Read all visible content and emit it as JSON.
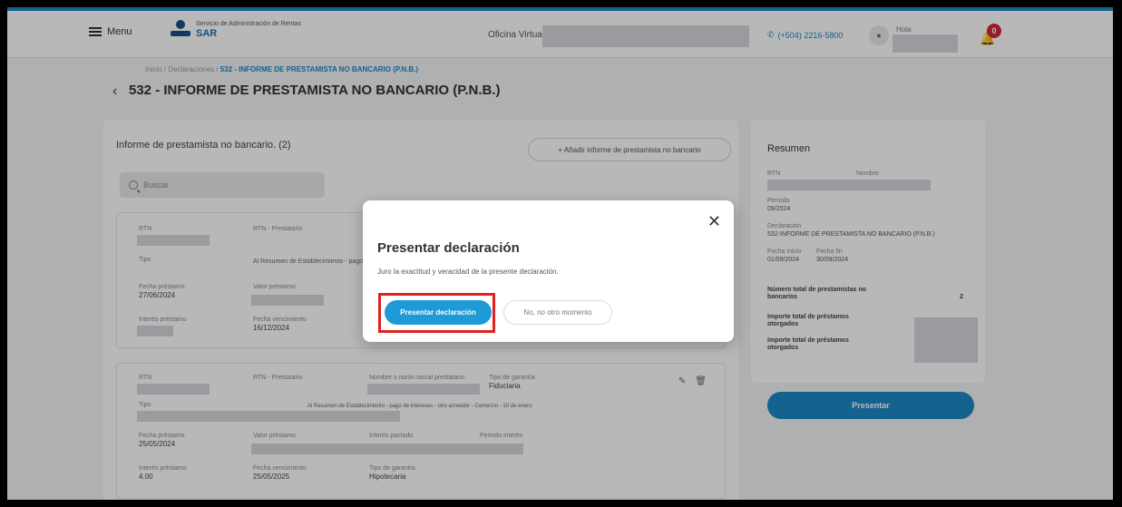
{
  "header": {
    "menu_label": "Menu",
    "logo_subtitle": "Servicio de Administración de Rentas",
    "logo_title": "SAR",
    "office_label": "Oficina Virtual",
    "phone": "(+504) 2216-5800",
    "user_label": "Hola",
    "notifications_count": "0"
  },
  "breadcrumb": {
    "path": "Inicio / Declaraciones / ",
    "current": "532 - INFORME DE PRESTAMISTA NO BANCARIO (P.N.B.)"
  },
  "page": {
    "title": "532 - INFORME DE PRESTAMISTA NO BANCARIO (P.N.B.)"
  },
  "list": {
    "heading": "Informe de prestamista no bancario. (2)",
    "add_button": "+ Añadir informe de prestamista no bancario",
    "search_placeholder": "Buscar",
    "records": [
      {
        "rtn_label": "RTN",
        "name_label": "RTN - Prestatario",
        "type_label": "Tipo",
        "type_value": "Al Resumen de Establecimiento - pago",
        "date_label": "Fecha préstamo",
        "date_value": "27/06/2024",
        "amount_label": "Valor préstamo",
        "interest_label": "Interés préstamo",
        "due_label": "Fecha vencimiento",
        "due_value": "16/12/2024"
      },
      {
        "rtn_label": "RTN",
        "name_label": "RTN - Prestatario",
        "borrower_label": "Nombre o razón social prestatario",
        "guarantee_label": "Tipo de garantía",
        "guarantee_value": "Fiduciaria",
        "type_label": "Tipo",
        "type_value": "Al Resumen de Establecimiento - pago de intereses - otro acreedor - Comercio - 10 de enero",
        "date_label": "Fecha préstamo",
        "date_value": "25/05/2024",
        "amount_label": "Valor préstamo",
        "rate_label": "Interés pactado",
        "period_label": "Periodo interés",
        "interest_label": "Interés préstamo",
        "interest_value": "4.00",
        "due_label": "Fecha vencimiento",
        "due_value": "25/05/2025",
        "warranty_label": "Tipo de garantía",
        "warranty_value": "Hipotecaria"
      }
    ]
  },
  "summary": {
    "title": "Resumen",
    "rtn_label": "RTN",
    "name_label": "Nombre",
    "period_label": "Período",
    "period_value": "09/2024",
    "declaration_label": "Declaración",
    "declaration_value": "532-INFORME DE PRESTAMISTA NO BANCARIO (P.N.B.)",
    "start_label": "Fecha inicio",
    "start_value": "01/09/2024",
    "end_label": "Fecha fin",
    "end_value": "30/09/2024",
    "total_loans_label": "Número total de prestamistas no bancarios",
    "total_loans_value": "2",
    "interest_received_label": "Importe total de préstamos otorgados",
    "interest_paid_label": "Importe total de préstamos otorgados",
    "present_button": "Presentar"
  },
  "modal": {
    "title": "Presentar declaración",
    "text": "Juro la exactitud y veracidad de la presente declaración.",
    "confirm_button": "Presentar declaración",
    "cancel_button": "No, no otro momento"
  },
  "colors": {
    "accent": "#1e88c7",
    "highlight": "#e0211f",
    "badge": "#d22638"
  }
}
